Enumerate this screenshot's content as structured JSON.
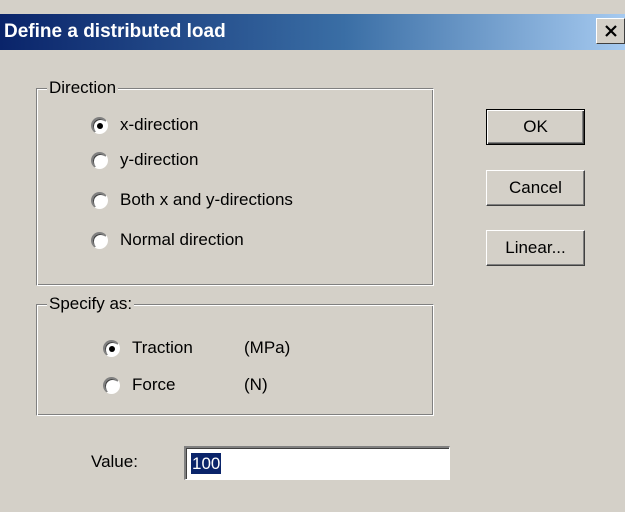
{
  "window": {
    "title": "Define a distributed load",
    "close_symbol": "×"
  },
  "direction": {
    "legend": "Direction",
    "options": [
      {
        "label": "x-direction",
        "selected": true
      },
      {
        "label": "y-direction",
        "selected": false
      },
      {
        "label": "Both x and y-directions",
        "selected": false
      },
      {
        "label": "Normal direction",
        "selected": false
      }
    ]
  },
  "specify": {
    "legend": "Specify as:",
    "options": [
      {
        "label": "Traction",
        "unit": "(MPa)",
        "selected": true
      },
      {
        "label": "Force",
        "unit": "(N)",
        "selected": false
      }
    ]
  },
  "buttons": {
    "ok": "OK",
    "cancel": "Cancel",
    "linear": "Linear..."
  },
  "value": {
    "label": "Value:",
    "current": "100"
  },
  "colors": {
    "title_bar_start": "#0a246a",
    "title_bar_end": "#a6caf0",
    "dialog_bg": "#d4d0c8",
    "selection": "#0a246a"
  }
}
